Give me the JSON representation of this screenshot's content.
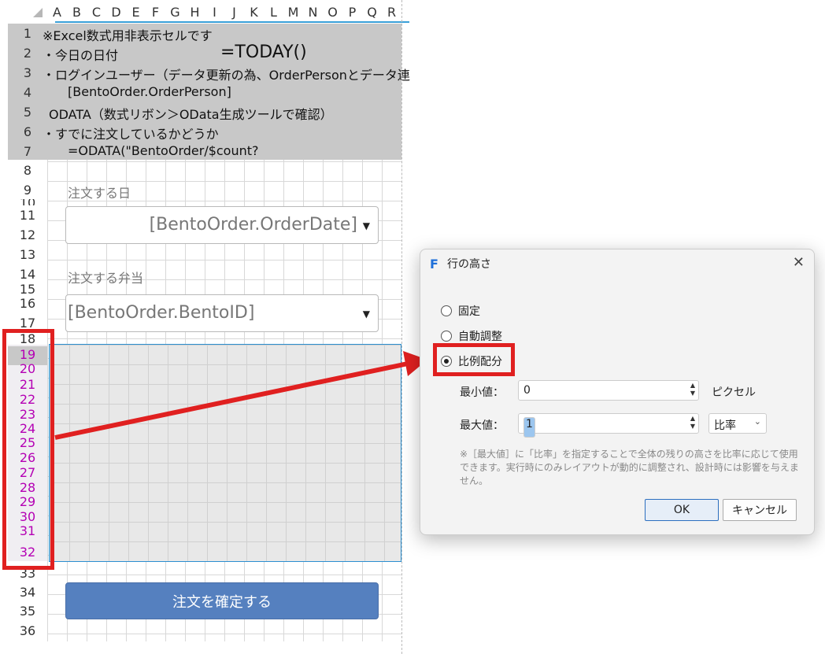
{
  "columns": [
    "A",
    "B",
    "C",
    "D",
    "E",
    "F",
    "G",
    "H",
    "I",
    "J",
    "K",
    "L",
    "M",
    "N",
    "O",
    "P",
    "Q",
    "R"
  ],
  "rows": [
    {
      "n": "1",
      "mag": false
    },
    {
      "n": "2",
      "mag": false
    },
    {
      "n": "3",
      "mag": false
    },
    {
      "n": "4",
      "mag": false
    },
    {
      "n": "5",
      "mag": false
    },
    {
      "n": "6",
      "mag": false
    },
    {
      "n": "7",
      "mag": false
    },
    {
      "n": "8",
      "mag": false
    },
    {
      "n": "9",
      "mag": false
    },
    {
      "n": "10",
      "mag": false
    },
    {
      "n": "11",
      "mag": false
    },
    {
      "n": "12",
      "mag": false
    },
    {
      "n": "13",
      "mag": false
    },
    {
      "n": "14",
      "mag": false
    },
    {
      "n": "15",
      "mag": false
    },
    {
      "n": "16",
      "mag": false
    },
    {
      "n": "17",
      "mag": false
    },
    {
      "n": "18",
      "mag": false
    },
    {
      "n": "19",
      "mag": true
    },
    {
      "n": "20",
      "mag": true
    },
    {
      "n": "21",
      "mag": true
    },
    {
      "n": "22",
      "mag": true
    },
    {
      "n": "23",
      "mag": true
    },
    {
      "n": "24",
      "mag": true
    },
    {
      "n": "25",
      "mag": true
    },
    {
      "n": "26",
      "mag": true
    },
    {
      "n": "27",
      "mag": true
    },
    {
      "n": "28",
      "mag": true
    },
    {
      "n": "29",
      "mag": true
    },
    {
      "n": "30",
      "mag": true
    },
    {
      "n": "31",
      "mag": true
    },
    {
      "n": "32",
      "mag": true
    },
    {
      "n": "33",
      "mag": false
    },
    {
      "n": "34",
      "mag": false
    },
    {
      "n": "35",
      "mag": false
    },
    {
      "n": "36",
      "mag": false
    }
  ],
  "notes": {
    "l1": "※Excel数式用非表示セルです",
    "l2": "・今日の日付",
    "today": "=TODAY()",
    "l3": "・ログインユーザー（データ更新の為、OrderPersonとデータ連",
    "l4": "[BentoOrder.OrderPerson]",
    "l5": "ODATA（数式リボン＞OData生成ツールで確認）",
    "l6": "・すでに注文しているかどうか",
    "l7": "=ODATA(\"BentoOrder/$count?"
  },
  "form": {
    "date_label": "注文する日",
    "date_value": "[BentoOrder.OrderDate]",
    "bento_label": "注文する弁当",
    "bento_value": "[BentoOrder.BentoID]",
    "confirm_button": "注文を確定する"
  },
  "dialog": {
    "title": "行の高さ",
    "close": "✕",
    "app_icon": "F",
    "radio_fixed": "固定",
    "radio_auto": "自動調整",
    "radio_ratio": "比例配分",
    "selected": "比例配分",
    "min_label": "最小値：",
    "min_value": "0",
    "min_unit": "ピクセル",
    "max_label": "最大値：",
    "max_value": "1",
    "max_unit": "比率",
    "hint": "※［最大値］に「比率」を指定することで全体の残りの高さを比率に応じて使用できます。実行時にのみレイアウトが動的に調整され、設計時には影響を与えません。",
    "ok": "OK",
    "cancel": "キャンセル"
  },
  "colors": {
    "annotation_red": "#e02020",
    "selection_blue": "#2c8fd0",
    "button_blue": "#5580bf",
    "row_magenta": "#b400b4"
  }
}
